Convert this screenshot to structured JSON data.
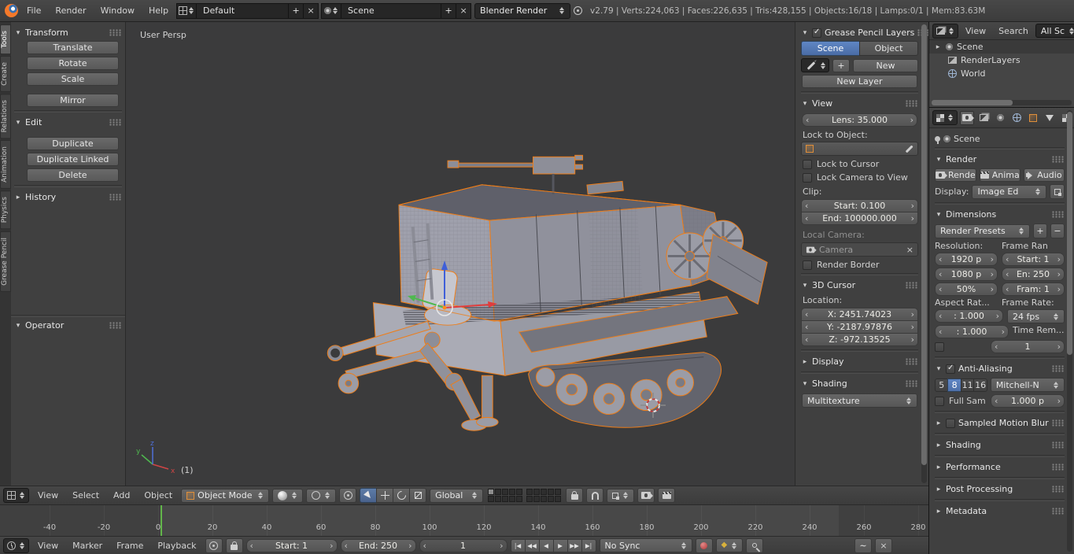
{
  "colors": {
    "accent_blue": "#5680c2",
    "selection_orange": "#ff8c19",
    "frame_line_green": "#62b54a",
    "record_red": "#b23535",
    "header_bg": "#3c3c3c",
    "viewport_bg": "#3b3b3c"
  },
  "top_header": {
    "menus": [
      "File",
      "Render",
      "Window",
      "Help"
    ],
    "layout": "Default",
    "scene": "Scene",
    "engine": "Blender Render",
    "stats": "v2.79 | Verts:224,063 | Faces:226,635 | Tris:428,155 | Objects:16/18 | Lamps:0/1 | Mem:83.63M"
  },
  "tool_shelf": {
    "tabs": [
      "Tools",
      "Create",
      "Relations",
      "Animation",
      "Physics",
      "Grease Pencil"
    ],
    "panels": {
      "transform": {
        "title": "Transform",
        "translate": "Translate",
        "rotate": "Rotate",
        "scale": "Scale",
        "mirror": "Mirror"
      },
      "edit": {
        "title": "Edit",
        "duplicate": "Duplicate",
        "duplicate_linked": "Duplicate Linked",
        "delete": "Delete"
      },
      "history": {
        "title": "History"
      },
      "operator": {
        "title": "Operator"
      }
    }
  },
  "viewport": {
    "view_label": "User Persp",
    "object_label": "(1)",
    "axis": {
      "x": "x",
      "y": "y",
      "z": "z"
    }
  },
  "vp_sidebar": {
    "gp": {
      "title": "Grease Pencil Layers",
      "tabs": [
        "Scene",
        "Object"
      ],
      "active_tab": "Scene",
      "new_button": "New",
      "new_layer_button": "New Layer"
    },
    "view": {
      "title": "View",
      "lens": "Lens: 35.000",
      "lock_to_object": "Lock to Object:",
      "lock_to_cursor": "Lock to Cursor",
      "lock_camera": "Lock Camera to View",
      "clip": "Clip:",
      "clip_start": "Start: 0.100",
      "clip_end": "End: 100000.000",
      "local_camera": "Local Camera:",
      "camera": "Camera",
      "render_border": "Render Border"
    },
    "cursor": {
      "title": "3D Cursor",
      "location": "Location:",
      "x": "X: 2451.74023",
      "y": "Y: -2187.97876",
      "z": "Z: -972.13525"
    },
    "display": {
      "title": "Display"
    },
    "shading": {
      "title": "Shading",
      "mode": "Multitexture"
    }
  },
  "outliner": {
    "menus": [
      "View",
      "Search"
    ],
    "scope": "All Sc",
    "items": [
      {
        "label": "Scene"
      },
      {
        "label": "RenderLayers"
      },
      {
        "label": "World"
      }
    ]
  },
  "properties": {
    "context": "Scene",
    "render": {
      "title": "Render",
      "buttons": [
        "Rende",
        "Anima",
        "Audio"
      ],
      "display_label": "Display:",
      "display_value": "Image Ed"
    },
    "dimensions": {
      "title": "Dimensions",
      "presets": "Render Presets",
      "resolution_label": "Resolution:",
      "frame_range_label": "Frame Ran",
      "res_x": "1920 p",
      "res_y": "1080 p",
      "res_pct": "50%",
      "frame_start": "Start: 1",
      "frame_end": "En: 250",
      "frame_step": "Fram: 1",
      "aspect_label": "Aspect Rat...",
      "frame_rate_label": "Frame Rate:",
      "aspect_x": ": 1.000",
      "aspect_y": ": 1.000",
      "fps": "24 fps",
      "time_label": "Time Rem...",
      "time_value": "1"
    },
    "antialiasing": {
      "title": "Anti-Aliasing",
      "samples": [
        "5",
        "8",
        "11",
        "16"
      ],
      "active_sample": "8",
      "filter": "Mitchell-N",
      "full_sample": "Full Sam",
      "pixel_size": "1.000 p"
    },
    "collapsed": [
      "Sampled Motion Blur",
      "Shading",
      "Performance",
      "Post Processing",
      "Metadata"
    ]
  },
  "vp_header": {
    "menus": [
      "View",
      "Select",
      "Add",
      "Object"
    ],
    "mode": "Object Mode",
    "orientation": "Global"
  },
  "timeline": {
    "ticks": [
      "-40",
      "-20",
      "0",
      "20",
      "40",
      "60",
      "80",
      "100",
      "120",
      "140",
      "160",
      "180",
      "200",
      "220",
      "240",
      "260",
      "280"
    ],
    "menus": [
      "View",
      "Marker",
      "Frame",
      "Playback"
    ],
    "start": "Start: 1",
    "end": "End: 250",
    "current": "1",
    "sync": "No Sync",
    "playback": [
      "|◀",
      "◀◀",
      "◀",
      "▶",
      "▶▶",
      "▶|"
    ]
  }
}
